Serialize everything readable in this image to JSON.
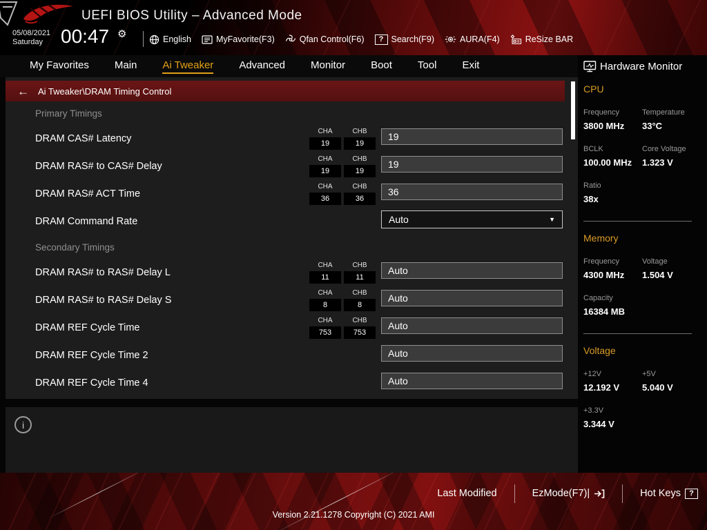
{
  "colors": {
    "accent_gold": "#e2a117",
    "breadcrumb_red": "#5c1212",
    "rog_red": "#c01818",
    "panel_gray": "#1d1d1d"
  },
  "icons": {
    "clock_settings_gear": "⚙",
    "back_arrow": "←",
    "dropdown_arrow": "▼",
    "info": "i",
    "question_mark": "?"
  },
  "header": {
    "title": "UEFI BIOS Utility – Advanced Mode",
    "date": "05/08/2021",
    "day": "Saturday",
    "time": "00:47",
    "toolbar": {
      "items": [
        {
          "icon": "globe-icon",
          "label": "English"
        },
        {
          "icon": "myfavorite-icon",
          "label": "MyFavorite(F3)"
        },
        {
          "icon": "qfan-icon",
          "label": "Qfan Control(F6)"
        },
        {
          "icon": "question-box-icon",
          "label": "Search(F9)"
        },
        {
          "icon": "aura-icon",
          "label": "AURA(F4)"
        },
        {
          "icon": "resize-bar-icon",
          "label": "ReSize BAR"
        }
      ]
    }
  },
  "menu": {
    "tabs": [
      {
        "label": "My Favorites",
        "active": false
      },
      {
        "label": "Main",
        "active": false
      },
      {
        "label": "Ai Tweaker",
        "active": true
      },
      {
        "label": "Advanced",
        "active": false
      },
      {
        "label": "Monitor",
        "active": false
      },
      {
        "label": "Boot",
        "active": false
      },
      {
        "label": "Tool",
        "active": false
      },
      {
        "label": "Exit",
        "active": false
      }
    ]
  },
  "breadcrumb": {
    "path": "Ai Tweaker\\DRAM Timing Control"
  },
  "settings": {
    "channels": {
      "a": "CHA",
      "b": "CHB"
    },
    "rows": [
      {
        "type": "section",
        "label": "Primary Timings"
      },
      {
        "type": "field",
        "label": "DRAM CAS# Latency",
        "cha": "19",
        "chb": "19",
        "value": "19",
        "control": "input"
      },
      {
        "type": "field",
        "label": "DRAM RAS# to CAS# Delay",
        "cha": "19",
        "chb": "19",
        "value": "19",
        "control": "input"
      },
      {
        "type": "field",
        "label": "DRAM RAS# ACT Time",
        "cha": "36",
        "chb": "36",
        "value": "36",
        "control": "input"
      },
      {
        "type": "field",
        "label": "DRAM Command Rate",
        "value": "Auto",
        "control": "select"
      },
      {
        "type": "section",
        "label": "Secondary Timings"
      },
      {
        "type": "field",
        "label": "DRAM RAS# to RAS# Delay L",
        "cha": "11",
        "chb": "11",
        "value": "Auto",
        "control": "input"
      },
      {
        "type": "field",
        "label": "DRAM RAS# to RAS# Delay S",
        "cha": "8",
        "chb": "8",
        "value": "Auto",
        "control": "input"
      },
      {
        "type": "field",
        "label": "DRAM REF Cycle Time",
        "cha": "753",
        "chb": "753",
        "value": "Auto",
        "control": "input"
      },
      {
        "type": "field",
        "label": "DRAM REF Cycle Time 2",
        "value": "Auto",
        "control": "input"
      },
      {
        "type": "field",
        "label": "DRAM REF Cycle Time 4",
        "value": "Auto",
        "control": "input"
      }
    ]
  },
  "hardware_monitor": {
    "title": "Hardware Monitor",
    "cpu": {
      "title": "CPU",
      "freq_label": "Frequency",
      "freq": "3800 MHz",
      "temp_label": "Temperature",
      "temp": "33°C",
      "bclk_label": "BCLK",
      "bclk": "100.00 MHz",
      "vcore_label": "Core Voltage",
      "vcore": "1.323 V",
      "ratio_label": "Ratio",
      "ratio": "38x"
    },
    "memory": {
      "title": "Memory",
      "freq_label": "Frequency",
      "freq": "4300 MHz",
      "volt_label": "Voltage",
      "volt": "1.504 V",
      "cap_label": "Capacity",
      "cap": "16384 MB"
    },
    "voltage": {
      "title": "Voltage",
      "v12_label": "+12V",
      "v12": "12.192 V",
      "v5_label": "+5V",
      "v5": "5.040 V",
      "v33_label": "+3.3V",
      "v33": "3.344 V"
    }
  },
  "footer": {
    "last_modified_label": "Last Modified",
    "ezmode_label": "EzMode(F7)|",
    "hotkeys_label": "Hot Keys",
    "version": "Version 2.21.1278 Copyright (C) 2021 AMI"
  }
}
